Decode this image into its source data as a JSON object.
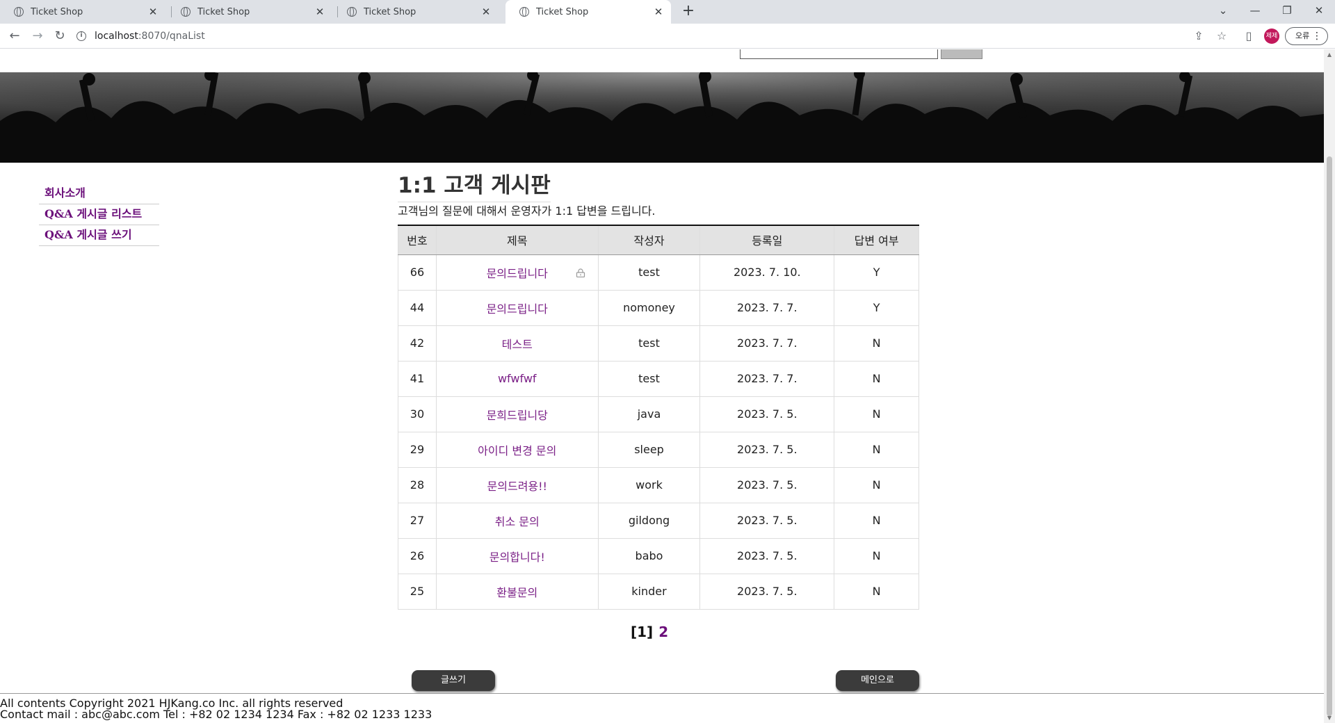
{
  "browser": {
    "tabs": [
      {
        "title": "Ticket Shop",
        "active": false
      },
      {
        "title": "Ticket Shop",
        "active": false
      },
      {
        "title": "Ticket Shop",
        "active": false
      },
      {
        "title": "Ticket Shop",
        "active": true
      }
    ],
    "url_host": "localhost",
    "url_path": ":8070/qnaList",
    "profile_label": "제제",
    "error_button": "오류"
  },
  "sidebar": {
    "items": [
      {
        "label": "회사소개"
      },
      {
        "label": "Q&A 게시글 리스트"
      },
      {
        "label": "Q&A 게시글 쓰기"
      }
    ]
  },
  "main": {
    "title": "1:1 고객 게시판",
    "description": "고객님의 질문에 대해서 운영자가 1:1 답변을 드립니다."
  },
  "table": {
    "headers": [
      "번호",
      "제목",
      "작성자",
      "등록일",
      "답변 여부"
    ],
    "rows": [
      {
        "no": "66",
        "subject": "문의드립니다",
        "writer": "test",
        "date": "2023. 7. 10.",
        "answered": "Y",
        "locked": true
      },
      {
        "no": "44",
        "subject": "문의드립니다",
        "writer": "nomoney",
        "date": "2023. 7. 7.",
        "answered": "Y",
        "locked": false
      },
      {
        "no": "42",
        "subject": "테스트",
        "writer": "test",
        "date": "2023. 7. 7.",
        "answered": "N",
        "locked": false
      },
      {
        "no": "41",
        "subject": "wfwfwf",
        "writer": "test",
        "date": "2023. 7. 7.",
        "answered": "N",
        "locked": false
      },
      {
        "no": "30",
        "subject": "문희드립니당",
        "writer": "java",
        "date": "2023. 7. 5.",
        "answered": "N",
        "locked": false
      },
      {
        "no": "29",
        "subject": "아이디 변경 문의",
        "writer": "sleep",
        "date": "2023. 7. 5.",
        "answered": "N",
        "locked": false
      },
      {
        "no": "28",
        "subject": "문의드려용!!",
        "writer": "work",
        "date": "2023. 7. 5.",
        "answered": "N",
        "locked": false
      },
      {
        "no": "27",
        "subject": "취소 문의",
        "writer": "gildong",
        "date": "2023. 7. 5.",
        "answered": "N",
        "locked": false
      },
      {
        "no": "26",
        "subject": "문의합니다!",
        "writer": "babo",
        "date": "2023. 7. 5.",
        "answered": "N",
        "locked": false
      },
      {
        "no": "25",
        "subject": "환불문의",
        "writer": "kinder",
        "date": "2023. 7. 5.",
        "answered": "N",
        "locked": false
      }
    ]
  },
  "pager": {
    "current": "[1]",
    "next": "2"
  },
  "buttons": {
    "write": "글쓰기",
    "main": "메인으로"
  },
  "footer": {
    "line1": "All contents Copyright 2021 HJKang.co Inc. all rights reserved",
    "line2": "Contact mail : abc@abc.com Tel : +82 02 1234 1234 Fax : +82 02 1233 1233"
  },
  "colors": {
    "link": "#6b0f7a",
    "subject": "#7a1f86",
    "button": "#3b3b3b",
    "banner": "#0d0d0d"
  }
}
